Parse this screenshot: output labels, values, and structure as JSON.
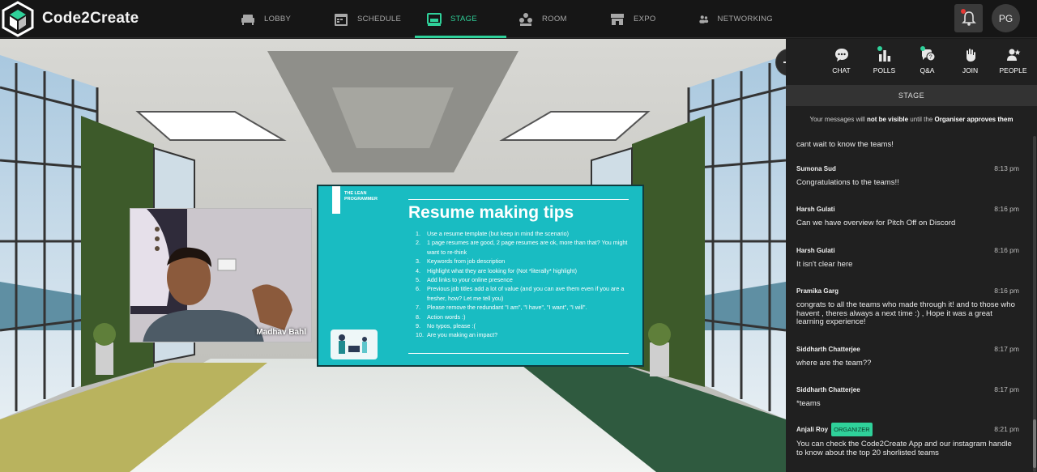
{
  "app": {
    "name": "Code2Create"
  },
  "nav": [
    {
      "label": "LOBBY",
      "icon": "sofa-icon"
    },
    {
      "label": "SCHEDULE",
      "icon": "calendar-icon"
    },
    {
      "label": "STAGE",
      "icon": "stage-icon",
      "active": true
    },
    {
      "label": "ROOM",
      "icon": "room-icon"
    },
    {
      "label": "EXPO",
      "icon": "expo-icon"
    },
    {
      "label": "NETWORKING",
      "icon": "networking-icon"
    }
  ],
  "user": {
    "initials": "PG"
  },
  "video": {
    "speaker": "Madhav Bahl"
  },
  "slide": {
    "brand": "THE LEAN PROGRAMMER",
    "title": "Resume making tips",
    "tips": [
      {
        "n": "1.",
        "t": "Use a resume template (but keep in mind the scenario)"
      },
      {
        "n": "2.",
        "t": "1 page resumes are good, 2 page resumes are ok, more than that? You might want to re-think"
      },
      {
        "n": "3.",
        "t": "Keywords from job description"
      },
      {
        "n": "4.",
        "t": "Highlight what they are looking for (Not *literally* highlight)"
      },
      {
        "n": "5.",
        "t": "Add links to your online presence"
      },
      {
        "n": "6.",
        "t": "Previous job titles add a lot of value (and you can ave them even if you are a fresher, how? Let me tell you)"
      },
      {
        "n": "7.",
        "t": "Please remove the redundant \"I am\", \"I have\", \"I want\", \"I will\"."
      },
      {
        "n": "8.",
        "t": "Action words :)"
      },
      {
        "n": "9.",
        "t": "No typos, please :("
      },
      {
        "n": "10.",
        "t": "Are you making an impact?"
      }
    ]
  },
  "side_tabs": [
    {
      "label": "CHAT",
      "icon": "chat-icon",
      "dot": false
    },
    {
      "label": "POLLS",
      "icon": "polls-icon",
      "dot": true
    },
    {
      "label": "Q&A",
      "icon": "qa-icon",
      "dot": true
    },
    {
      "label": "JOIN",
      "icon": "hand-icon",
      "dot": false
    },
    {
      "label": "PEOPLE",
      "icon": "people-icon",
      "dot": false
    }
  ],
  "chat": {
    "header": "STAGE",
    "notice_prefix": "Your messages will ",
    "notice_bold1": "not be visible",
    "notice_mid": " until the ",
    "notice_bold2": "Organiser approves them",
    "first_text": "cant wait to know the teams!",
    "messages": [
      {
        "author": "Sumona Sud",
        "time": "8:13 pm",
        "text": "Congratulations to the teams!!",
        "badge": ""
      },
      {
        "author": "Harsh Gulati",
        "time": "8:16 pm",
        "text": "Can we have overview for Pitch Off on Discord",
        "badge": ""
      },
      {
        "author": "Harsh Gulati",
        "time": "8:16 pm",
        "text": "It isn't clear here",
        "badge": ""
      },
      {
        "author": "Pramika Garg",
        "time": "8:16 pm",
        "text": "congrats to all the teams who made through it! and to those who havent , theres always a next time :) , Hope it was a great learning experience!",
        "badge": ""
      },
      {
        "author": "Siddharth Chatterjee",
        "time": "8:17 pm",
        "text": "where are the team??",
        "badge": ""
      },
      {
        "author": "Siddharth Chatterjee",
        "time": "8:17 pm",
        "text": "*teams",
        "badge": ""
      },
      {
        "author": "Anjali Roy",
        "time": "8:21 pm",
        "text": "You can check the Code2Create App and our instagram handle to know about the top 20 shorlisted teams",
        "badge": "ORGANIZER"
      }
    ]
  },
  "colors": {
    "accent": "#2fd19a",
    "slide_bg": "#19bcc2",
    "panel_bg": "#202020"
  }
}
